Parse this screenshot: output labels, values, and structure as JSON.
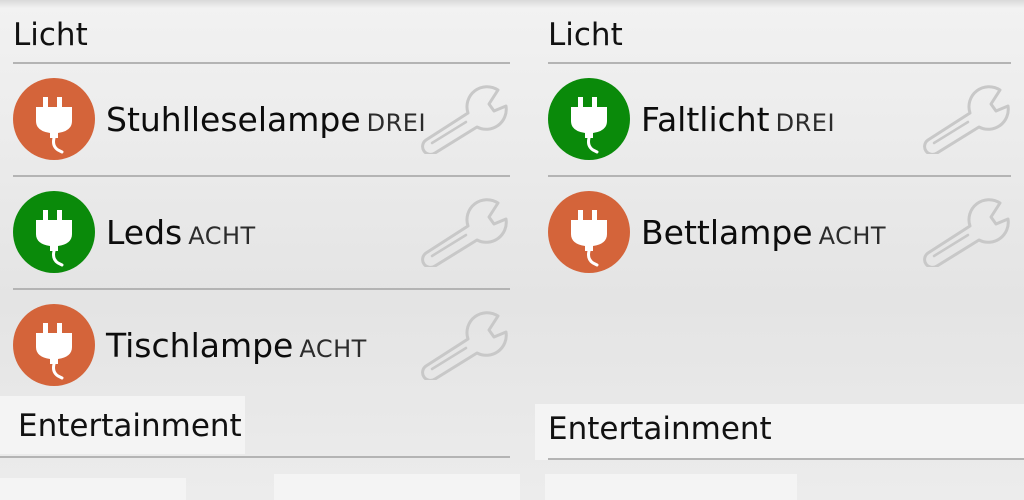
{
  "colors": {
    "on": "#0a8a0a",
    "off": "#d4643a",
    "divider": "#b4b4b4"
  },
  "icons": {
    "socket": "plug-icon",
    "settings": "wrench-icon"
  },
  "left": {
    "section1": "Licht",
    "items": [
      {
        "name": "Stuhlleselampe",
        "tag": "DREI",
        "state": "off"
      },
      {
        "name": "Leds",
        "tag": "ACHT",
        "state": "on"
      },
      {
        "name": "Tischlampe",
        "tag": "ACHT",
        "state": "off"
      }
    ],
    "section2": "Entertainment"
  },
  "right": {
    "section1": "Licht",
    "items": [
      {
        "name": "Faltlicht",
        "tag": "DREI",
        "state": "on"
      },
      {
        "name": "Bettlampe",
        "tag": "ACHT",
        "state": "off"
      }
    ],
    "section2": "Entertainment"
  }
}
